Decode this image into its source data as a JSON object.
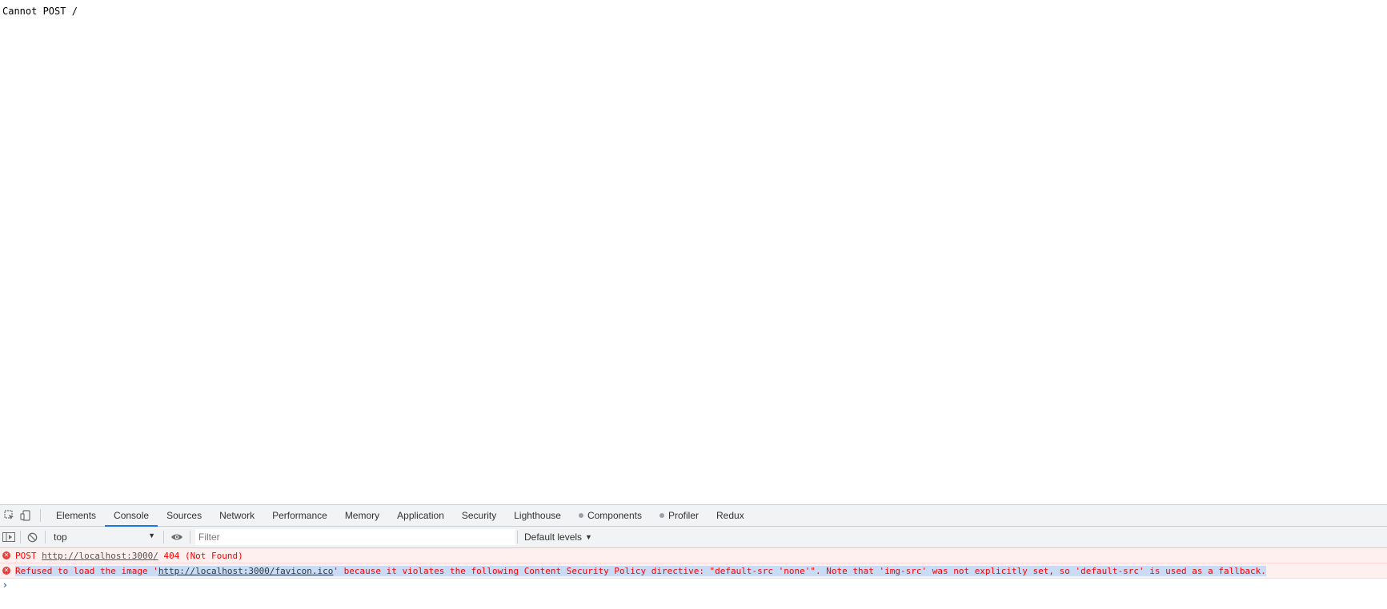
{
  "page": {
    "text": "Cannot POST /"
  },
  "devtools": {
    "tools": [
      {
        "icon": "inspect-element-icon"
      },
      {
        "icon": "device-toggle-icon"
      }
    ],
    "tabs": [
      {
        "label": "Elements",
        "active": false,
        "has_icon": false
      },
      {
        "label": "Console",
        "active": true,
        "has_icon": false
      },
      {
        "label": "Sources",
        "active": false,
        "has_icon": false
      },
      {
        "label": "Network",
        "active": false,
        "has_icon": false
      },
      {
        "label": "Performance",
        "active": false,
        "has_icon": false
      },
      {
        "label": "Memory",
        "active": false,
        "has_icon": false
      },
      {
        "label": "Application",
        "active": false,
        "has_icon": false
      },
      {
        "label": "Security",
        "active": false,
        "has_icon": false
      },
      {
        "label": "Lighthouse",
        "active": false,
        "has_icon": false
      },
      {
        "label": "Components",
        "active": false,
        "has_icon": true
      },
      {
        "label": "Profiler",
        "active": false,
        "has_icon": true
      },
      {
        "label": "Redux",
        "active": false,
        "has_icon": false
      }
    ],
    "toolbar": {
      "context": "top",
      "filter_placeholder": "Filter",
      "filter_value": "",
      "levels": "Default levels"
    },
    "messages": [
      {
        "level": "error",
        "prefix": "POST ",
        "link": "http://localhost:3000/",
        "suffix": " 404 (Not Found)"
      },
      {
        "level": "error",
        "prefix": "Refused to load the image '",
        "link": "http://localhost:3000/favicon.ico",
        "suffix": "' because it violates the following Content Security Policy directive: \"default-src 'none'\". Note that 'img-src' was not explicitly set, so 'default-src' is used as a fallback."
      }
    ],
    "prompt_glyph": "›",
    "colors": {
      "accent": "#1a73e8",
      "error_text": "#ff0000",
      "error_bg": "#fff0f0",
      "selection": "#c8dcf5"
    }
  }
}
